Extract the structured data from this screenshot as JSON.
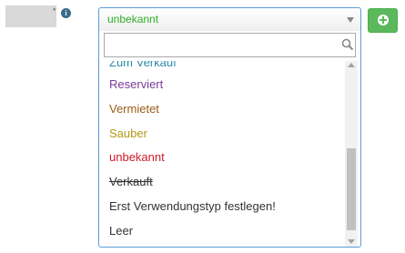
{
  "field": {
    "required_marker": "*",
    "info_icon": "info-icon"
  },
  "select": {
    "value": "unbekannt",
    "value_color": "#2fae27",
    "arrow_icon": "chevron-down-icon"
  },
  "add_button": {
    "icon": "plus-circle-icon",
    "color": "#5cb85c"
  },
  "search": {
    "value": "",
    "placeholder": "",
    "icon": "search-icon"
  },
  "options": [
    {
      "label": "Zum Verkauf",
      "color": "#2a8ba8",
      "strikethrough": false,
      "partially_visible": true
    },
    {
      "label": "Reserviert",
      "color": "#7b3a9a",
      "strikethrough": false
    },
    {
      "label": "Vermietet",
      "color": "#9a5a16",
      "strikethrough": false
    },
    {
      "label": "Sauber",
      "color": "#b39a17",
      "strikethrough": false
    },
    {
      "label": "unbekannt",
      "color": "#d11a2a",
      "strikethrough": false
    },
    {
      "label": "Verkauft",
      "color": "#333333",
      "strikethrough": true
    },
    {
      "label": "Erst Verwendungstyp festlegen!",
      "color": "#333333",
      "strikethrough": false
    },
    {
      "label": "Leer",
      "color": "#333333",
      "strikethrough": false
    }
  ]
}
